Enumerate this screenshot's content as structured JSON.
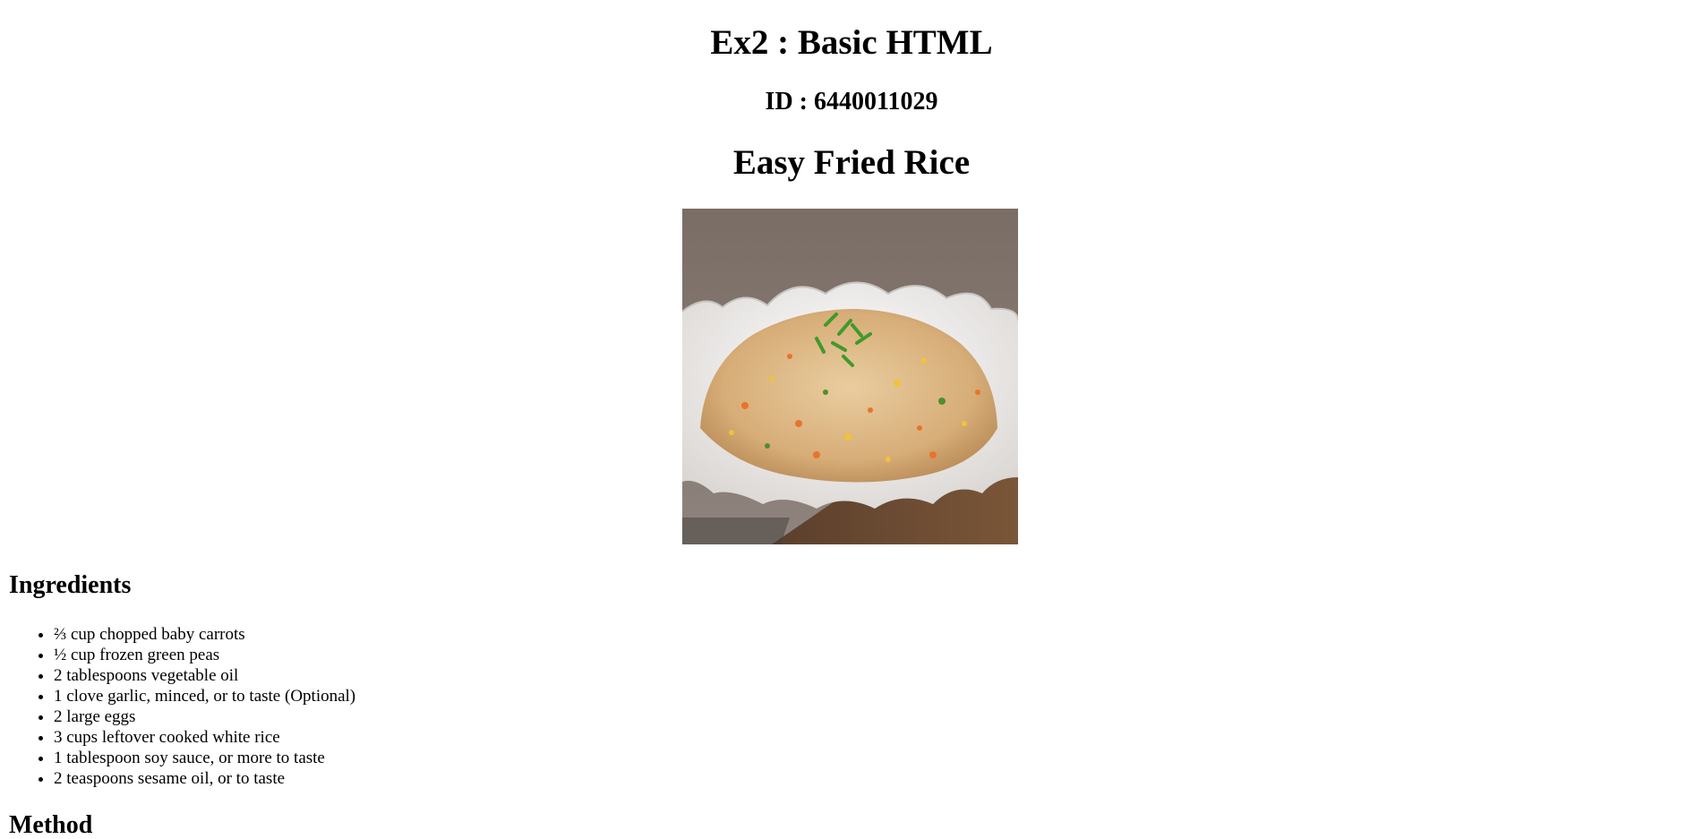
{
  "header": {
    "title": "Ex2 : Basic HTML",
    "id_line": "ID : 6440011029",
    "recipe_title": "Easy Fried Rice"
  },
  "image": {
    "icon": "fried-rice-photo",
    "colors": {
      "background": "#7b6f66",
      "plate": "#f1efed",
      "board": "#6a4a33",
      "rice": "#dcb785"
    }
  },
  "ingredients": {
    "heading": "Ingredients",
    "items": [
      "⅔ cup chopped baby carrots",
      "½ cup frozen green peas",
      "2 tablespoons vegetable oil",
      "1 clove garlic, minced, or to taste (Optional)",
      "2 large eggs",
      "3 cups leftover cooked white rice",
      "1 tablespoon soy sauce, or more to taste",
      "2 teaspoons sesame oil, or to taste"
    ]
  },
  "method": {
    "heading": "Method"
  }
}
